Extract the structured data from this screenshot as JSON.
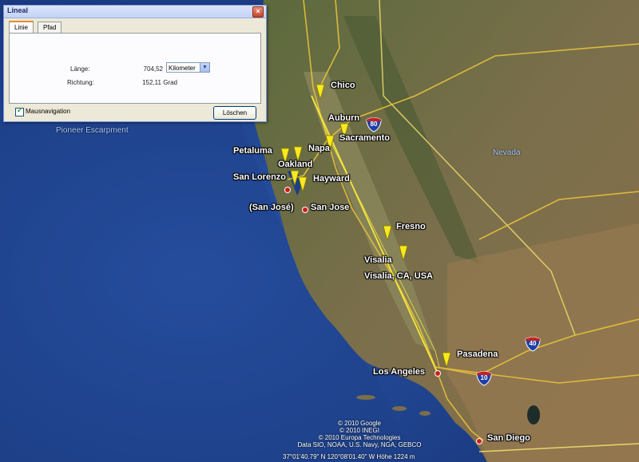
{
  "dialog": {
    "title": "Lineal",
    "close_symbol": "×",
    "tabs": [
      {
        "label": "Linie",
        "active": true
      },
      {
        "label": "Pfad",
        "active": false
      }
    ],
    "length_label": "Länge:",
    "length_value": "704,52",
    "unit_selected": "Kilometer",
    "direction_label": "Richtung:",
    "direction_value": "152,11 Grad",
    "checkbox_label": "Mausnavigation",
    "checkbox_checked": true,
    "clear_button": "Löschen"
  },
  "map": {
    "places": {
      "chico": "Chico",
      "auburn": "Auburn",
      "sacramento": "Sacramento",
      "napa": "Napa",
      "petaluma": "Petaluma",
      "oakland": "Oakland",
      "san_lorenzo": "San Lorenzo",
      "hayward": "Hayward",
      "san_jose_paren": "(San José)",
      "san_jose": "San Jose",
      "fresno": "Fresno",
      "visalia": "Visalia",
      "visalia_full": "Visalia, CA, USA",
      "pasadena": "Pasadena",
      "los_angeles": "Los Angeles",
      "san_diego": "San Diego"
    },
    "regions": {
      "nevada": "Nevada",
      "pioneer_escarpment": "Pioneer Escarpment"
    },
    "highways": {
      "i80": "80",
      "i40": "40",
      "i10": "10"
    },
    "ocean_color": "#1c3f8a",
    "land_color": "#6e6a45",
    "ruler_color": "#f3e73a",
    "road_color": "#e8c23c",
    "pin_color": "#f7ea1e"
  },
  "copyright": {
    "line1": "© 2010 Google",
    "line2": "© 2010 INEGI",
    "line3": "© 2010 Europa Technologies",
    "line4": "Data SIO, NOAA, U.S. Navy, NGA, GEBCO"
  },
  "status": {
    "coords": "37°01'40.79\" N    120°08'01.40\" W    Höhe 1224 m"
  }
}
